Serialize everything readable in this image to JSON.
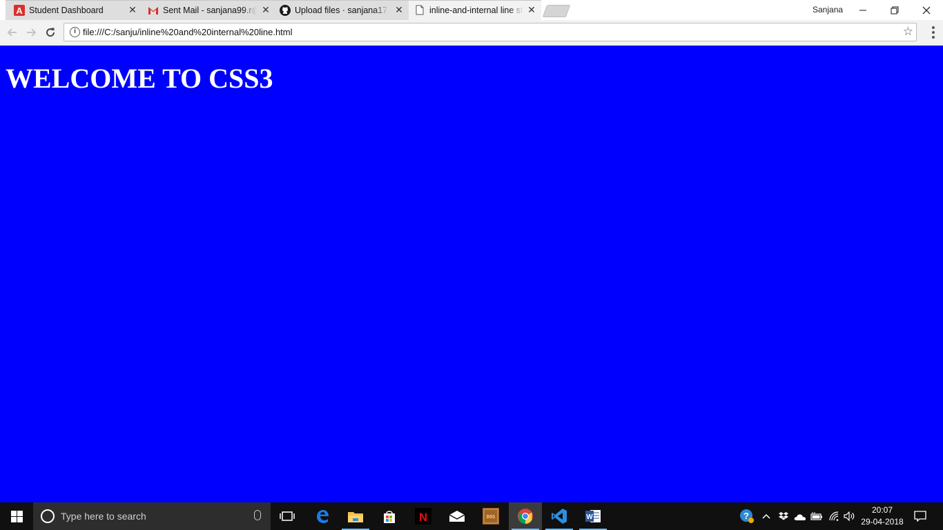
{
  "browser": {
    "tabs": [
      {
        "title": "Student Dashboard",
        "icon": "red-a-icon"
      },
      {
        "title": "Sent Mail - sanjana99.r@",
        "icon": "gmail-icon"
      },
      {
        "title": "Upload files · sanjana17r/",
        "icon": "github-icon"
      },
      {
        "title": "inline-and-internal line st",
        "icon": "page-icon",
        "active": true
      }
    ],
    "profile_name": "Sanjana",
    "address": "file:///C:/sanju/inline%20and%20internal%20line.html"
  },
  "page": {
    "heading": "WELCOME TO CSS3",
    "background": "#0000ff",
    "text_color": "#ffffff"
  },
  "taskbar": {
    "search_placeholder": "Type here to search",
    "time": "20:07",
    "date": "29-04-2018",
    "pinned": [
      "task-view-icon",
      "edge-icon",
      "file-explorer-icon",
      "store-icon",
      "netflix-icon",
      "mail-icon",
      "dosbox-icon",
      "chrome-icon",
      "vscode-icon",
      "word-icon"
    ]
  }
}
